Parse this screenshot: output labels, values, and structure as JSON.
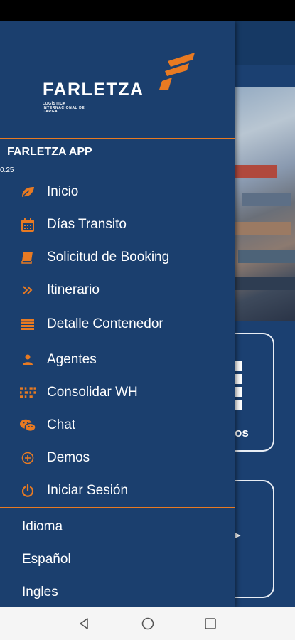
{
  "brand": {
    "name": "FARLETZA",
    "tagline": "LOGÍSTICA INTERNACIONAL DE CARGA",
    "accent_color": "#e87a22",
    "drawer_bg": "#1b3f6e"
  },
  "drawer": {
    "app_title": "FARLETZA APP",
    "version": "0.25",
    "menu": [
      {
        "label": "Inicio",
        "icon": "leaf-icon"
      },
      {
        "label": "Días Transito",
        "icon": "calendar-icon"
      },
      {
        "label": "Solicitud de Booking",
        "icon": "book-icon"
      },
      {
        "label": "Itinerario",
        "icon": "double-chevron-right-icon"
      },
      {
        "label": "Detalle Contenedor",
        "icon": "list-icon"
      },
      {
        "label": "Agentes",
        "icon": "person-icon"
      },
      {
        "label": "Consolidar WH",
        "icon": "barcode-grid-icon"
      },
      {
        "label": "Chat",
        "icon": "wechat-icon"
      },
      {
        "label": "Demos",
        "icon": "plus-circle-icon"
      },
      {
        "label": "Iniciar Sesión",
        "icon": "power-icon"
      }
    ],
    "language_items": [
      "Idioma",
      "Español",
      "Ingles"
    ]
  },
  "background": {
    "card_partial_text": "os"
  },
  "navbar": {
    "buttons": [
      "back-icon",
      "home-icon",
      "recents-icon"
    ]
  }
}
